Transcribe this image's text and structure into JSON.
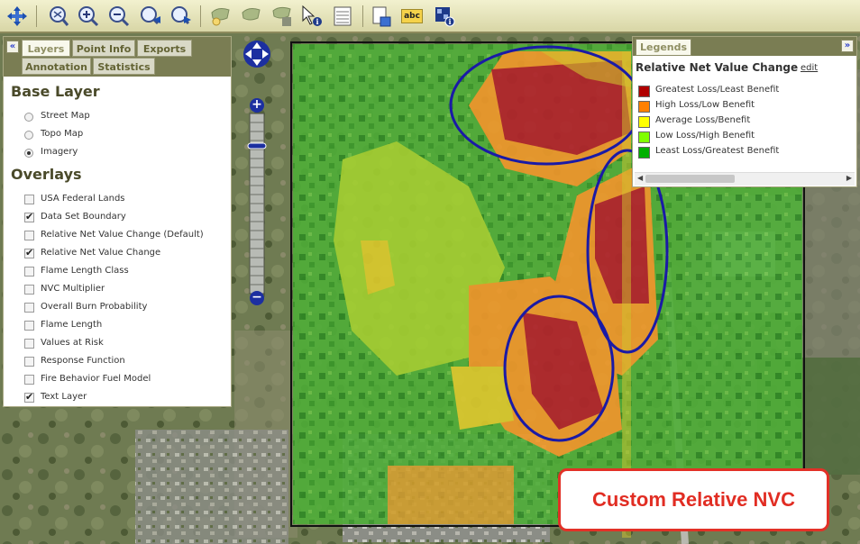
{
  "toolbar": {
    "tools": [
      {
        "name": "pan-tool-icon",
        "icon": "pan-arrows"
      },
      {
        "name": "zoom-full-extent-icon",
        "icon": "full-extent"
      },
      {
        "name": "zoom-in-icon",
        "icon": "magnifier-plus"
      },
      {
        "name": "zoom-out-icon",
        "icon": "magnifier-minus"
      },
      {
        "name": "previous-extent-icon",
        "icon": "magnifier-back"
      },
      {
        "name": "next-extent-icon",
        "icon": "magnifier-forward"
      },
      {
        "name": "select-features-icon",
        "icon": "map-layer-select"
      },
      {
        "name": "clear-selection-icon",
        "icon": "map-layer-clear"
      },
      {
        "name": "selection-info-icon",
        "icon": "map-layer-info"
      },
      {
        "name": "identify-icon",
        "icon": "pointer-info"
      },
      {
        "name": "attribute-table-icon",
        "icon": "table"
      },
      {
        "name": "export-map-icon",
        "icon": "map-export"
      },
      {
        "name": "labels-icon",
        "icon": "abc"
      },
      {
        "name": "map-info-icon",
        "icon": "map-info"
      }
    ],
    "labels_icon_text": "abc"
  },
  "panel": {
    "collapse": "«",
    "tabs": [
      "Layers",
      "Point Info",
      "Exports",
      "Annotation",
      "Statistics"
    ],
    "base_layer_title": "Base Layer",
    "base_layers": [
      {
        "label": "Street Map",
        "selected": false
      },
      {
        "label": "Topo Map",
        "selected": false
      },
      {
        "label": "Imagery",
        "selected": true
      }
    ],
    "overlays_title": "Overlays",
    "overlays": [
      {
        "label": "USA Federal Lands",
        "checked": false
      },
      {
        "label": "Data Set Boundary",
        "checked": true
      },
      {
        "label": "Relative Net Value Change (Default)",
        "checked": false
      },
      {
        "label": "Relative Net Value Change",
        "checked": true
      },
      {
        "label": "Flame Length Class",
        "checked": false
      },
      {
        "label": "NVC Multiplier",
        "checked": false
      },
      {
        "label": "Overall Burn Probability",
        "checked": false
      },
      {
        "label": "Flame Length",
        "checked": false
      },
      {
        "label": "Values at Risk",
        "checked": false
      },
      {
        "label": "Response Function",
        "checked": false
      },
      {
        "label": "Fire Behavior Fuel Model",
        "checked": false
      },
      {
        "label": "Text Layer",
        "checked": true
      }
    ]
  },
  "legend": {
    "tab": "Legends",
    "toggle": "»",
    "title": "Relative Net Value Change",
    "edit": "edit",
    "items": [
      {
        "label": "Greatest Loss/Least Benefit",
        "color": "#b00000"
      },
      {
        "label": "High Loss/Low Benefit",
        "color": "#ff8000"
      },
      {
        "label": "Average Loss/Benefit",
        "color": "#ffff00"
      },
      {
        "label": "Low Loss/High Benefit",
        "color": "#80ff00"
      },
      {
        "label": "Least Loss/Greatest Benefit",
        "color": "#00b000"
      }
    ]
  },
  "zoom_control": {
    "plus": "+",
    "minus": "−",
    "zoom_level_fraction": 0.18
  },
  "callout": {
    "text": "Custom Relative NVC"
  }
}
